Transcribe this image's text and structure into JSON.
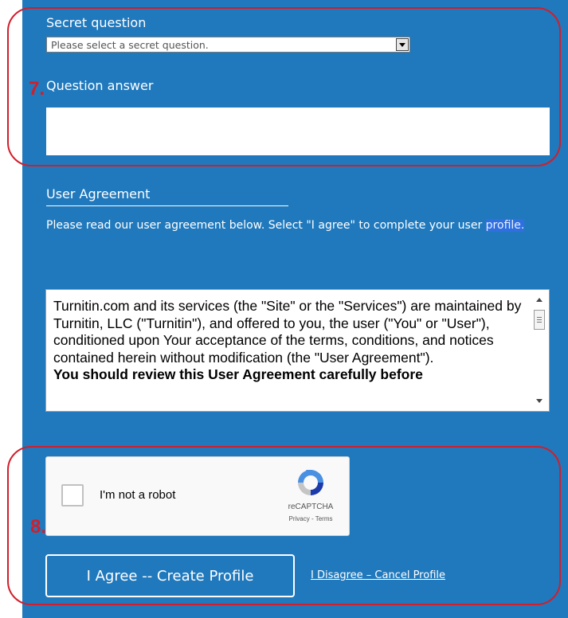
{
  "secret_question": {
    "label": "Secret question",
    "selected": "Please select a secret question."
  },
  "question_answer": {
    "label": "Question answer",
    "value": ""
  },
  "user_agreement": {
    "title": "User Agreement",
    "intro_text": "Please read our user agreement below. Select \"I agree\" to complete your user",
    "intro_link": "profile.",
    "body_text": "Turnitin.com and its services (the \"Site\" or the \"Services\") are maintained by Turnitin, LLC (\"Turnitin\"), and offered to you, the user (\"You\" or \"User\"), conditioned upon Your acceptance of the terms, conditions, and notices contained herein without modification (the \"User Agreement\").",
    "body_bold": "You should review this User Agreement carefully before"
  },
  "recaptcha": {
    "label": "I'm not a robot",
    "brand": "reCAPTCHA",
    "links": "Privacy - Terms",
    "checked": false
  },
  "actions": {
    "agree_label": "I Agree -- Create Profile",
    "disagree_label": "I Disagree – Cancel Profile"
  },
  "annotations": {
    "marker_7": "7.",
    "marker_8": "8."
  },
  "colors": {
    "panel_bg": "#2079bd",
    "annotation": "#d21e2a"
  }
}
